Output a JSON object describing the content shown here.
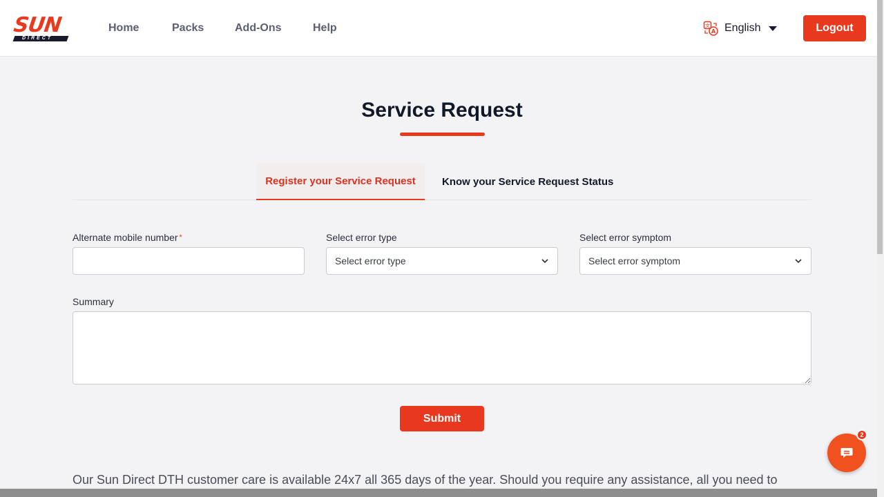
{
  "brand": {
    "logo_text": "SUN",
    "logo_subtext": "DIRECT",
    "accent_color": "#e8381e"
  },
  "nav": {
    "items": [
      {
        "label": "Home"
      },
      {
        "label": "Packs"
      },
      {
        "label": "Add-Ons"
      },
      {
        "label": "Help"
      }
    ]
  },
  "language": {
    "icon": "translate-icon",
    "selected": "English"
  },
  "header": {
    "logout_label": "Logout"
  },
  "page": {
    "title": "Service Request"
  },
  "tabs": [
    {
      "label": "Register your Service Request",
      "active": true
    },
    {
      "label": "Know your Service Request Status",
      "active": false
    }
  ],
  "form": {
    "mobile": {
      "label": "Alternate mobile number",
      "required_mark": "*",
      "value": ""
    },
    "error_type": {
      "label": "Select error type",
      "selected": "Select error type"
    },
    "error_symptom": {
      "label": "Select error symptom",
      "selected": "Select error symptom"
    },
    "summary": {
      "label": "Summary",
      "value": ""
    },
    "submit_label": "Submit"
  },
  "footer": {
    "care_text": "Our Sun Direct DTH customer care is available 24x7 all 365 days of the year. Should you require any assistance, all you need to"
  },
  "chat": {
    "icon": "chat-icon",
    "badge_count": "2"
  }
}
